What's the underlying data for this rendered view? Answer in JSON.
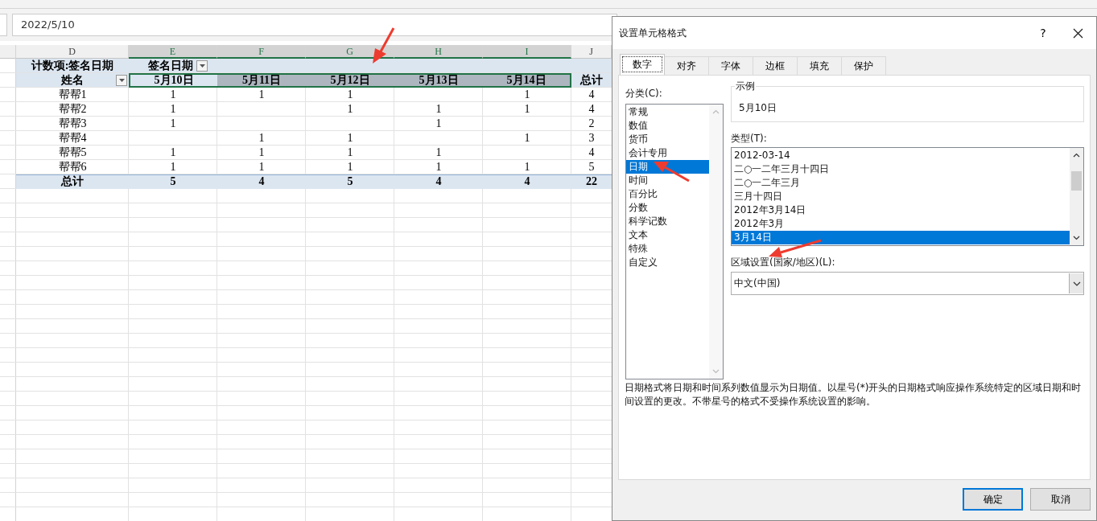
{
  "formula_bar": {
    "value": "2022/5/10"
  },
  "sheet": {
    "columns": [
      {
        "label": "D",
        "selected": false
      },
      {
        "label": "E",
        "selected": true
      },
      {
        "label": "F",
        "selected": true
      },
      {
        "label": "G",
        "selected": true
      },
      {
        "label": "H",
        "selected": true
      },
      {
        "label": "I",
        "selected": true
      },
      {
        "label": "J",
        "selected": false
      }
    ],
    "pivot": {
      "value_field": "计数项:签名日期",
      "column_field": "签名日期",
      "row_field": "姓名",
      "dates": [
        {
          "label": "5月10日",
          "selected": false
        },
        {
          "label": "5月11日",
          "selected": true
        },
        {
          "label": "5月12日",
          "selected": true
        },
        {
          "label": "5月13日",
          "selected": true
        },
        {
          "label": "5月14日",
          "selected": true
        }
      ],
      "total_header": "总计",
      "rows": [
        {
          "name": "帮帮1",
          "values": {
            "date_1": "1",
            "date_2": "1",
            "date_3": "1",
            "date_5": "1"
          },
          "total": "4"
        },
        {
          "name": "帮帮2",
          "values": {
            "date_1": "1",
            "date_3": "1",
            "date_4": "1",
            "date_5": "1"
          },
          "total": "4"
        },
        {
          "name": "帮帮3",
          "values": {
            "date_1": "1",
            "date_4": "1"
          },
          "total": "2"
        },
        {
          "name": "帮帮4",
          "values": {
            "date_2": "1",
            "date_3": "1",
            "date_5": "1"
          },
          "total": "3"
        },
        {
          "name": "帮帮5",
          "values": {
            "date_1": "1",
            "date_2": "1",
            "date_3": "1",
            "date_4": "1"
          },
          "total": "4"
        },
        {
          "name": "帮帮6",
          "values": {
            "date_1": "1",
            "date_2": "1",
            "date_3": "1",
            "date_4": "1",
            "date_5": "1"
          },
          "total": "5"
        }
      ],
      "grand_total": {
        "name": "总计",
        "values": [
          "5",
          "4",
          "5",
          "4",
          "4"
        ],
        "total": "22"
      }
    }
  },
  "dialog": {
    "title": "设置单元格格式",
    "help": "?",
    "tabs": [
      {
        "label": "数字",
        "selected": true
      },
      {
        "label": "对齐",
        "selected": false
      },
      {
        "label": "字体",
        "selected": false
      },
      {
        "label": "边框",
        "selected": false
      },
      {
        "label": "填充",
        "selected": false
      },
      {
        "label": "保护",
        "selected": false
      }
    ],
    "category_label": "分类(C):",
    "categories": [
      {
        "label": "常规",
        "selected": false
      },
      {
        "label": "数值",
        "selected": false
      },
      {
        "label": "货币",
        "selected": false
      },
      {
        "label": "会计专用",
        "selected": false
      },
      {
        "label": "日期",
        "selected": true
      },
      {
        "label": "时间",
        "selected": false
      },
      {
        "label": "百分比",
        "selected": false
      },
      {
        "label": "分数",
        "selected": false
      },
      {
        "label": "科学记数",
        "selected": false
      },
      {
        "label": "文本",
        "selected": false
      },
      {
        "label": "特殊",
        "selected": false
      },
      {
        "label": "自定义",
        "selected": false
      }
    ],
    "sample": {
      "legend": "示例",
      "value": "5月10日"
    },
    "type_label": "类型(T):",
    "types": [
      {
        "label": "2012-03-14",
        "selected": false
      },
      {
        "label": "二○一二年三月十四日",
        "selected": false
      },
      {
        "label": "二○一二年三月",
        "selected": false
      },
      {
        "label": "三月十四日",
        "selected": false
      },
      {
        "label": "2012年3月14日",
        "selected": false
      },
      {
        "label": "2012年3月",
        "selected": false
      },
      {
        "label": "3月14日",
        "selected": true
      }
    ],
    "locale_label": "区域设置(国家/地区)(L):",
    "locale": {
      "value": "中文(中国)"
    },
    "description": "日期格式将日期和时间系列数值显示为日期值。以星号(*)开头的日期格式响应操作系统特定的区域日期和时间设置的更改。不带星号的格式不受操作系统设置的影响。",
    "buttons": [
      {
        "label": "确定",
        "kind": "default"
      },
      {
        "label": "取消",
        "kind": "normal"
      }
    ]
  }
}
